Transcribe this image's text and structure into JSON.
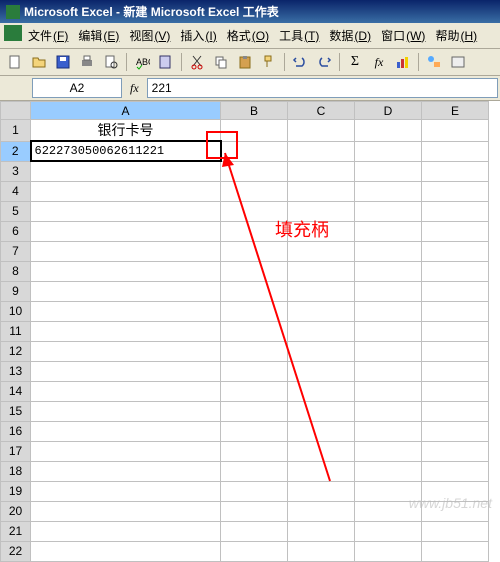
{
  "title": "Microsoft Excel - 新建 Microsoft Excel 工作表",
  "menus": {
    "file": "文件",
    "file_k": "(F)",
    "edit": "编辑",
    "edit_k": "(E)",
    "view": "视图",
    "view_k": "(V)",
    "insert": "插入",
    "insert_k": "(I)",
    "format": "格式",
    "format_k": "(O)",
    "tools": "工具",
    "tools_k": "(T)",
    "data": "数据",
    "data_k": "(D)",
    "window": "窗口",
    "window_k": "(W)",
    "help": "帮助",
    "help_k": "(H)"
  },
  "namebox": "A2",
  "formula": "221",
  "fx": "fx",
  "columns": [
    "A",
    "B",
    "C",
    "D",
    "E"
  ],
  "rows_count": 22,
  "cells": {
    "A1": "银行卡号",
    "A2": "622273050062611221"
  },
  "annotation": "填充柄",
  "watermark": "www.jb51.net"
}
